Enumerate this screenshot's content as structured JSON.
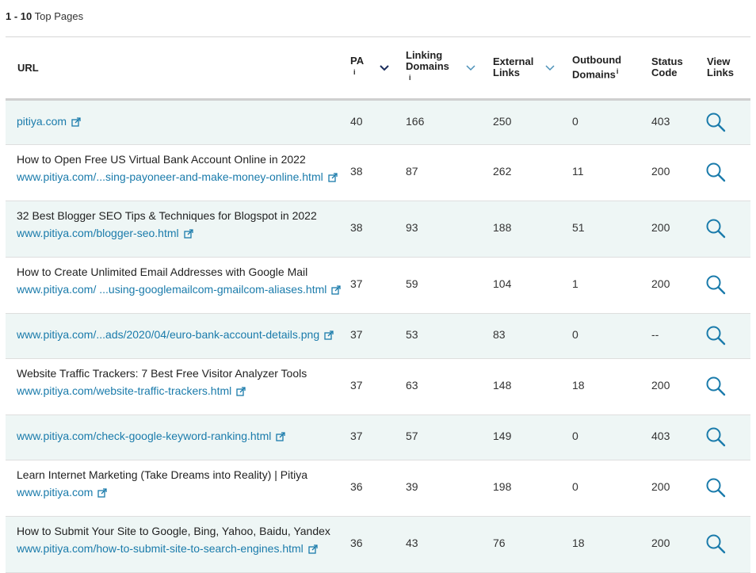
{
  "summary": {
    "range": "1 - 10",
    "label": "Top Pages"
  },
  "columns": {
    "url": "URL",
    "pa": "PA",
    "linking_domains": "Linking Domains",
    "external_links": "External Links",
    "outbound_domains": "Outbound Domains",
    "status_code": "Status Code",
    "view_links": "View Links",
    "info_glyph": "i"
  },
  "rows": [
    {
      "title": "",
      "url": "pitiya.com",
      "pa": "40",
      "ld": "166",
      "el": "250",
      "od": "0",
      "sc": "403"
    },
    {
      "title": "How to Open Free US Virtual Bank Account Online in 2022",
      "url": "www.pitiya.com/...sing-payoneer-and-make-money-online.html",
      "pa": "38",
      "ld": "87",
      "el": "262",
      "od": "11",
      "sc": "200"
    },
    {
      "title": "32 Best Blogger SEO Tips & Techniques for Blogspot in 2022",
      "url": "www.pitiya.com/blogger-seo.html",
      "pa": "38",
      "ld": "93",
      "el": "188",
      "od": "51",
      "sc": "200"
    },
    {
      "title": "How to Create Unlimited Email Addresses with Google Mail",
      "url": "www.pitiya.com/ ...using-googlemailcom-gmailcom-aliases.html",
      "pa": "37",
      "ld": "59",
      "el": "104",
      "od": "1",
      "sc": "200"
    },
    {
      "title": "",
      "url": "www.pitiya.com/...ads/2020/04/euro-bank-account-details.png",
      "pa": "37",
      "ld": "53",
      "el": "83",
      "od": "0",
      "sc": "--"
    },
    {
      "title": "Website Traffic Trackers: 7 Best Free Visitor Analyzer Tools",
      "url": "www.pitiya.com/website-traffic-trackers.html",
      "pa": "37",
      "ld": "63",
      "el": "148",
      "od": "18",
      "sc": "200"
    },
    {
      "title": "",
      "url": "www.pitiya.com/check-google-keyword-ranking.html",
      "pa": "37",
      "ld": "57",
      "el": "149",
      "od": "0",
      "sc": "403"
    },
    {
      "title": "Learn Internet Marketing (Take Dreams into Reality) | Pitiya",
      "url": "www.pitiya.com",
      "pa": "36",
      "ld": "39",
      "el": "198",
      "od": "0",
      "sc": "200"
    },
    {
      "title": "How to Submit Your Site to Google, Bing, Yahoo, Baidu, Yandex",
      "url": "www.pitiya.com/how-to-submit-site-to-search-engines.html",
      "pa": "36",
      "ld": "43",
      "el": "76",
      "od": "18",
      "sc": "200"
    }
  ],
  "icons": {
    "external": "external-link-icon",
    "view": "search-icon",
    "sort": "chevron-down-icon"
  },
  "colors": {
    "link": "#1a7bab",
    "alt_row": "#eef6f5",
    "sort_active": "#1a2c5b"
  }
}
